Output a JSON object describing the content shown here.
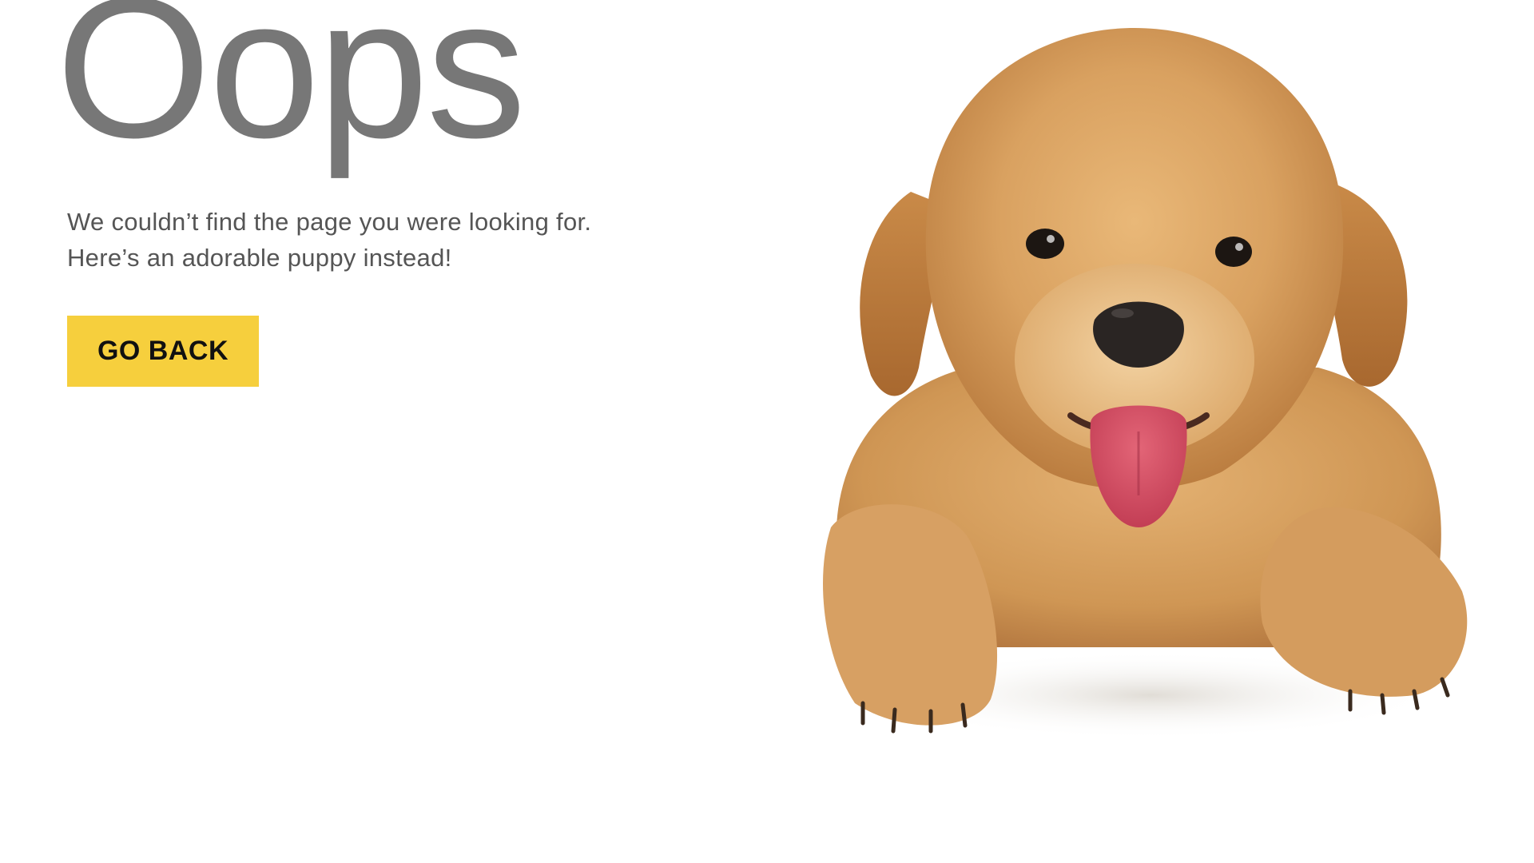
{
  "error_page": {
    "title": "Oops",
    "message_line1": "We couldn’t find the page you were looking for.",
    "message_line2": "Here’s an adorable puppy instead!",
    "back_button_label": "GO BACK"
  },
  "colors": {
    "background": "#FFFFFF",
    "title": "#777777",
    "message": "#555555",
    "button_bg": "#F6CF3D",
    "button_text": "#111111"
  },
  "image": {
    "subject": "golden-retriever-puppy"
  }
}
